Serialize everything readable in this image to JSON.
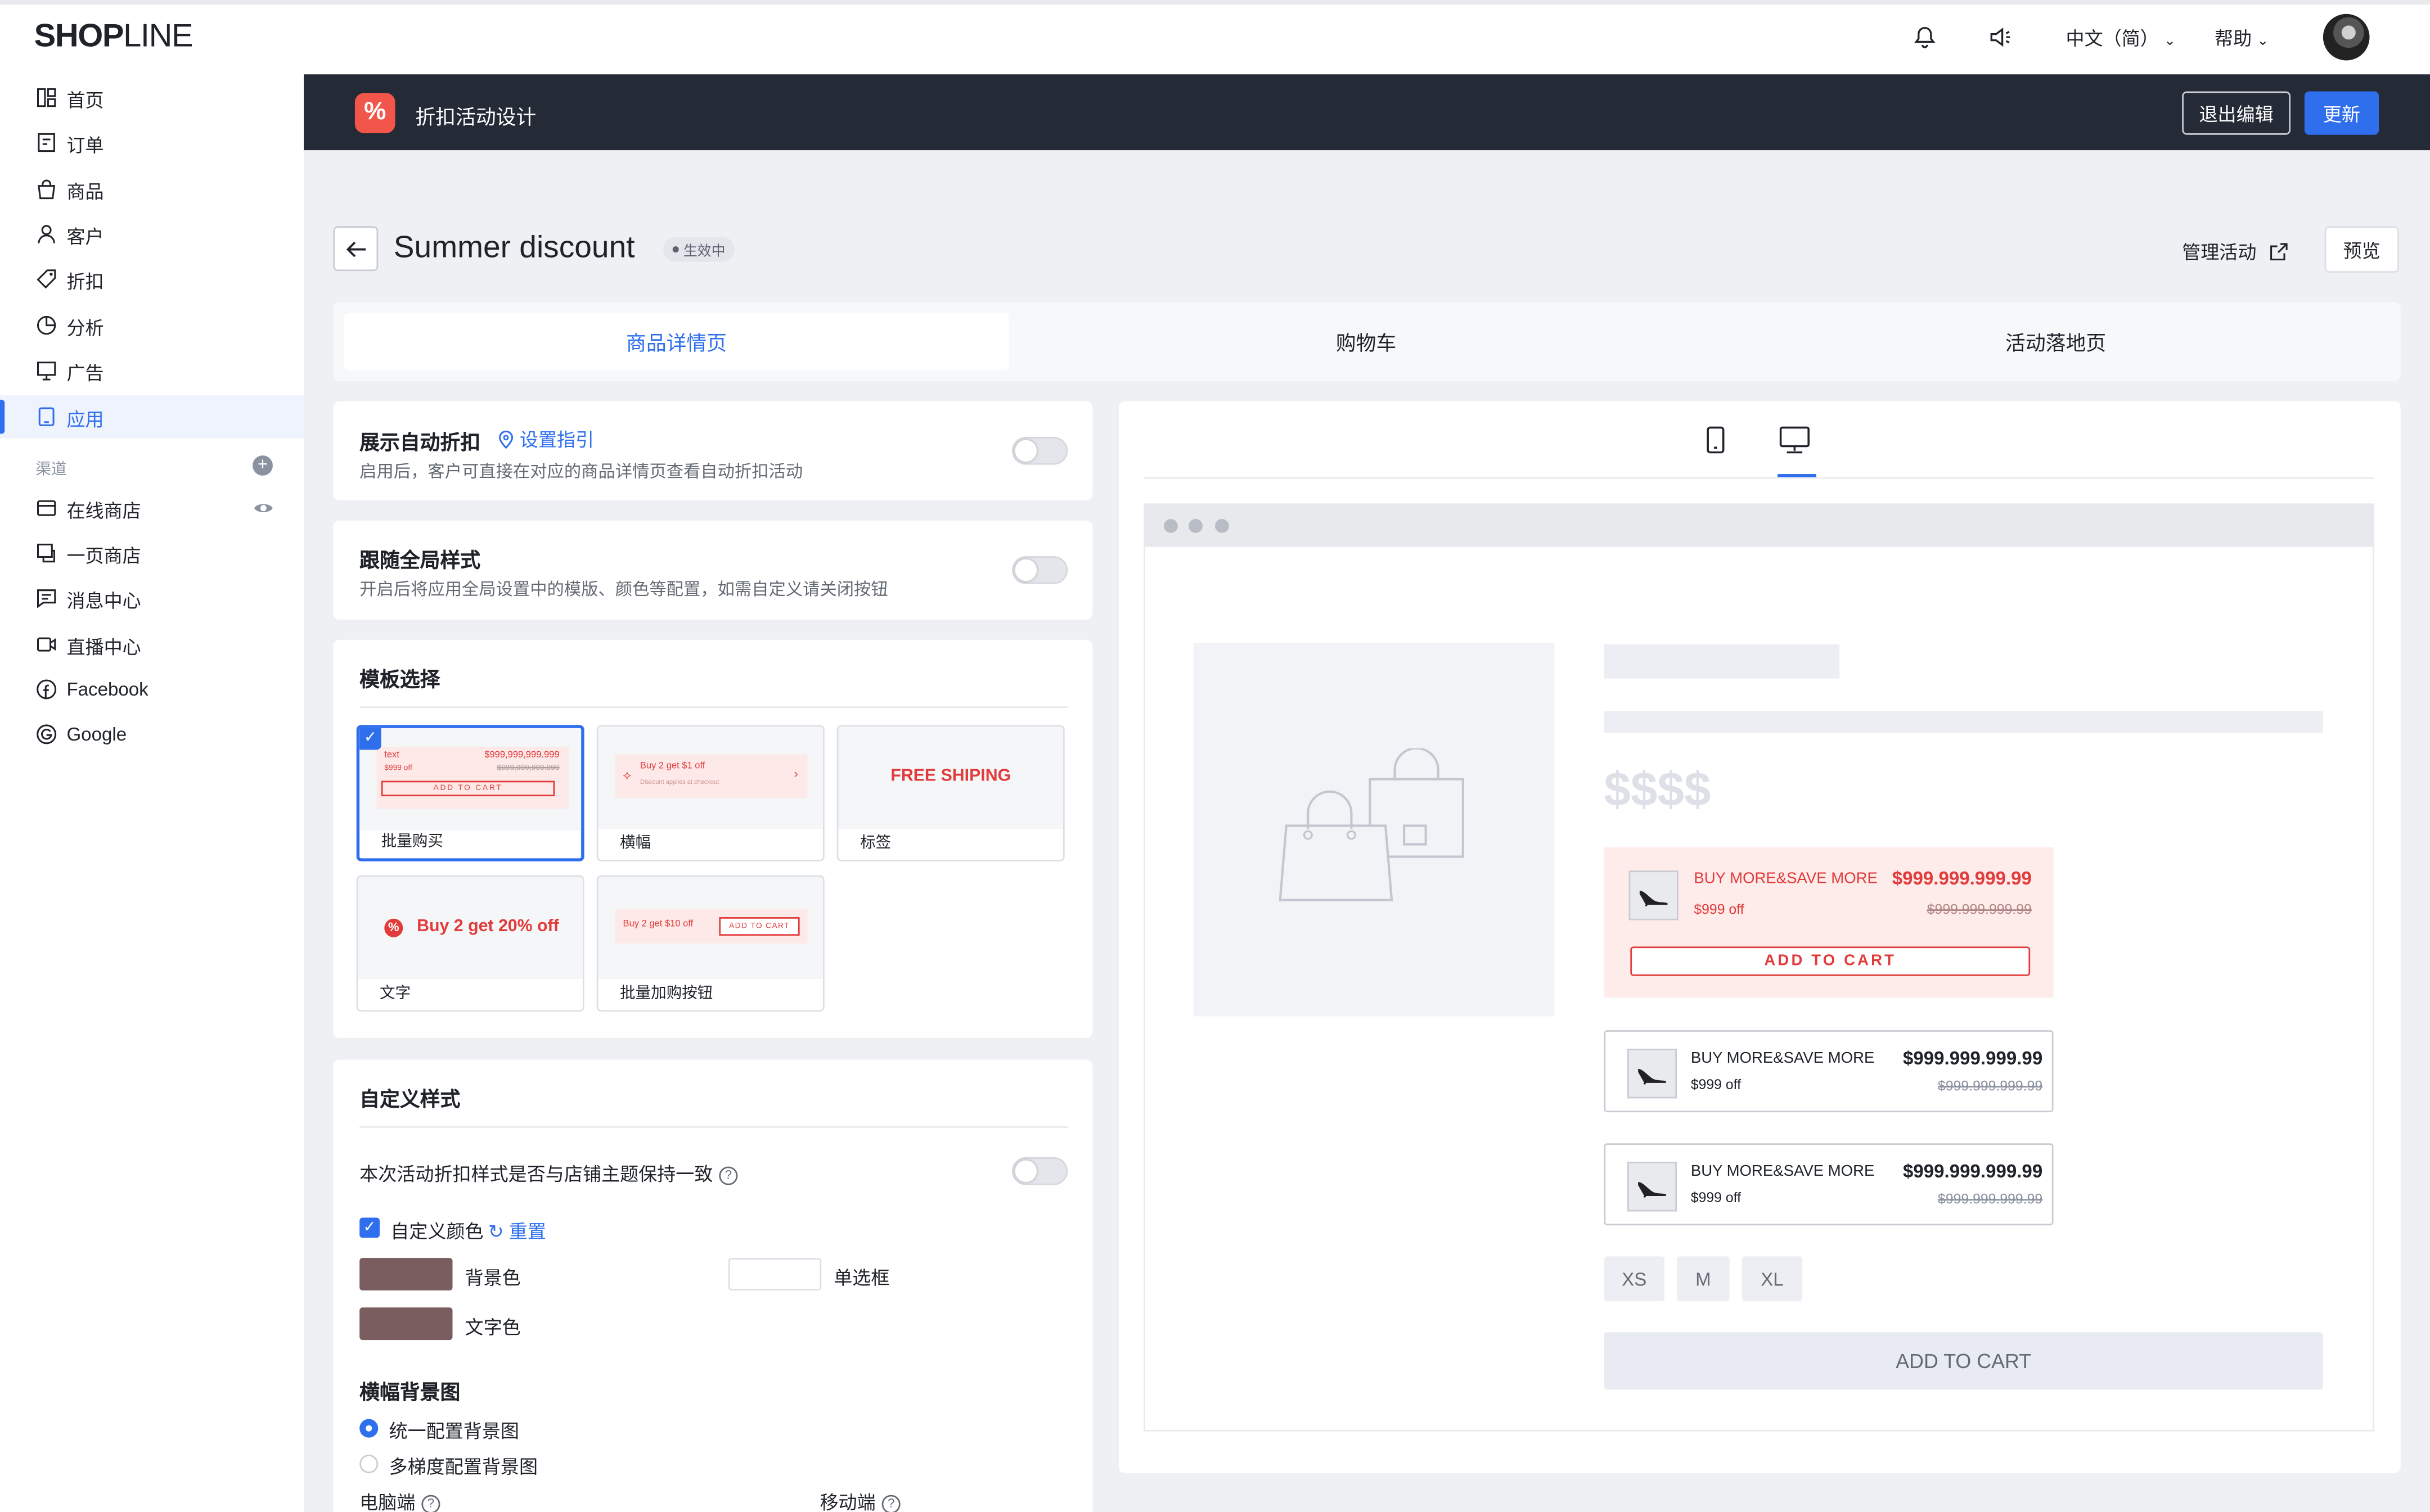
{
  "topbar": {
    "logo_bold": "SHOP",
    "logo_thin": "LINE",
    "language": "中文（简）",
    "help": "帮助"
  },
  "sidebar": {
    "items": [
      {
        "label": "首页",
        "icon": "dashboard-icon"
      },
      {
        "label": "订单",
        "icon": "order-icon"
      },
      {
        "label": "商品",
        "icon": "bag-icon"
      },
      {
        "label": "客户",
        "icon": "user-icon"
      },
      {
        "label": "折扣",
        "icon": "tag-icon"
      },
      {
        "label": "分析",
        "icon": "pie-chart-icon"
      },
      {
        "label": "广告",
        "icon": "ad-icon"
      },
      {
        "label": "应用",
        "icon": "app-icon"
      }
    ],
    "section_label": "渠道",
    "channels": [
      {
        "label": "在线商店",
        "icon": "store-icon"
      },
      {
        "label": "一页商店",
        "icon": "one-page-icon"
      },
      {
        "label": "消息中心",
        "icon": "message-icon"
      },
      {
        "label": "直播中心",
        "icon": "live-icon"
      },
      {
        "label": "Facebook",
        "icon": "facebook-icon"
      },
      {
        "label": "Google",
        "icon": "google-icon"
      }
    ]
  },
  "header": {
    "badge": "%",
    "title": "折扣活动设计",
    "exit_label": "退出编辑",
    "update_label": "更新"
  },
  "page": {
    "title": "Summer discount",
    "status": "生效中",
    "manage_label": "管理活动",
    "preview_label": "预览"
  },
  "tabs": [
    "商品详情页",
    "购物车",
    "活动落地页"
  ],
  "settings": {
    "auto_discount_title": "展示自动折扣",
    "guide_link": "设置指引",
    "auto_discount_desc": "启用后，客户可直接在对应的商品详情页查看自动折扣活动",
    "global_style_title": "跟随全局样式",
    "global_style_desc": "开启后将应用全局设置中的模版、颜色等配置，如需自定义请关闭按钮"
  },
  "templates": {
    "title": "模板选择",
    "items": [
      {
        "name": "批量购买",
        "selected": true
      },
      {
        "name": "横幅",
        "selected": false
      },
      {
        "name": "标签",
        "selected": false,
        "preview_text": "FREE SHIPING"
      },
      {
        "name": "文字",
        "selected": false,
        "preview_text": "Buy 2 get 20% off"
      },
      {
        "name": "批量加购按钮",
        "selected": false
      }
    ],
    "mini_bulk": {
      "line1": "text",
      "price": "$999,999,999.999",
      "sub": "$999 off",
      "strike": "$999,999,999.999",
      "button": "ADD TO CART"
    },
    "mini_banner": {
      "line1": "Buy 2 get $1 off",
      "line2": "Discount applies at checkout"
    },
    "mini_bulkbtn": {
      "text": "Buy 2 get $10 off",
      "button": "ADD TO CART"
    }
  },
  "custom": {
    "title": "自定义样式",
    "theme_question": "本次活动折扣样式是否与店铺主题保持一致",
    "custom_color_label": "自定义颜色",
    "reset_label": "重置",
    "bg_color_label": "背景色",
    "radio_box_label": "单选框",
    "text_color_label": "文字色",
    "swatch_color": "#7a5d5f",
    "banner_bg_title": "横幅背景图",
    "option_uniform": "统一配置背景图",
    "option_tiered": "多梯度配置背景图",
    "desktop_label": "电脑端",
    "mobile_label": "移动端"
  },
  "preview": {
    "price_placeholder": "$$$$",
    "highlight_offer": {
      "title": "BUY MORE&SAVE MORE",
      "price": "$999.999.999.99",
      "sub": "$999 off",
      "strike": "$999.999.999.99",
      "button": "ADD TO CART"
    },
    "offers": [
      {
        "title": "BUY MORE&SAVE MORE",
        "price": "$999.999.999.99",
        "sub": "$999 off",
        "strike": "$999.999.999.99"
      },
      {
        "title": "BUY MORE&SAVE MORE",
        "price": "$999.999.999.99",
        "sub": "$999 off",
        "strike": "$999.999.999.99"
      }
    ],
    "sizes": [
      "XS",
      "M",
      "XL"
    ],
    "add_to_cart": "ADD TO CART",
    "accent_color": "#e23b3b",
    "brand_blue": "#2f6fed"
  }
}
